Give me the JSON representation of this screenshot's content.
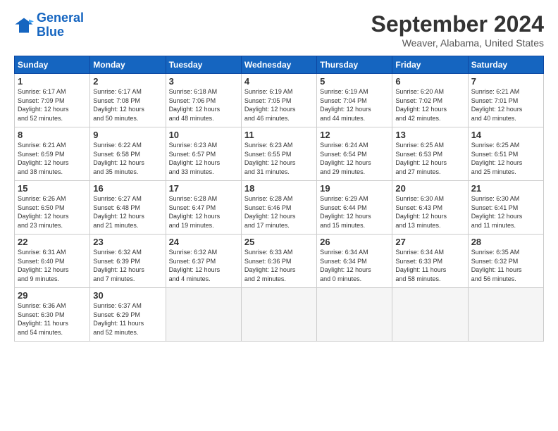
{
  "logo": {
    "line1": "General",
    "line2": "Blue"
  },
  "title": "September 2024",
  "location": "Weaver, Alabama, United States",
  "days_of_week": [
    "Sunday",
    "Monday",
    "Tuesday",
    "Wednesday",
    "Thursday",
    "Friday",
    "Saturday"
  ],
  "weeks": [
    [
      {
        "day": "1",
        "info": "Sunrise: 6:17 AM\nSunset: 7:09 PM\nDaylight: 12 hours\nand 52 minutes."
      },
      {
        "day": "2",
        "info": "Sunrise: 6:17 AM\nSunset: 7:08 PM\nDaylight: 12 hours\nand 50 minutes."
      },
      {
        "day": "3",
        "info": "Sunrise: 6:18 AM\nSunset: 7:06 PM\nDaylight: 12 hours\nand 48 minutes."
      },
      {
        "day": "4",
        "info": "Sunrise: 6:19 AM\nSunset: 7:05 PM\nDaylight: 12 hours\nand 46 minutes."
      },
      {
        "day": "5",
        "info": "Sunrise: 6:19 AM\nSunset: 7:04 PM\nDaylight: 12 hours\nand 44 minutes."
      },
      {
        "day": "6",
        "info": "Sunrise: 6:20 AM\nSunset: 7:02 PM\nDaylight: 12 hours\nand 42 minutes."
      },
      {
        "day": "7",
        "info": "Sunrise: 6:21 AM\nSunset: 7:01 PM\nDaylight: 12 hours\nand 40 minutes."
      }
    ],
    [
      {
        "day": "8",
        "info": "Sunrise: 6:21 AM\nSunset: 6:59 PM\nDaylight: 12 hours\nand 38 minutes."
      },
      {
        "day": "9",
        "info": "Sunrise: 6:22 AM\nSunset: 6:58 PM\nDaylight: 12 hours\nand 35 minutes."
      },
      {
        "day": "10",
        "info": "Sunrise: 6:23 AM\nSunset: 6:57 PM\nDaylight: 12 hours\nand 33 minutes."
      },
      {
        "day": "11",
        "info": "Sunrise: 6:23 AM\nSunset: 6:55 PM\nDaylight: 12 hours\nand 31 minutes."
      },
      {
        "day": "12",
        "info": "Sunrise: 6:24 AM\nSunset: 6:54 PM\nDaylight: 12 hours\nand 29 minutes."
      },
      {
        "day": "13",
        "info": "Sunrise: 6:25 AM\nSunset: 6:53 PM\nDaylight: 12 hours\nand 27 minutes."
      },
      {
        "day": "14",
        "info": "Sunrise: 6:25 AM\nSunset: 6:51 PM\nDaylight: 12 hours\nand 25 minutes."
      }
    ],
    [
      {
        "day": "15",
        "info": "Sunrise: 6:26 AM\nSunset: 6:50 PM\nDaylight: 12 hours\nand 23 minutes."
      },
      {
        "day": "16",
        "info": "Sunrise: 6:27 AM\nSunset: 6:48 PM\nDaylight: 12 hours\nand 21 minutes."
      },
      {
        "day": "17",
        "info": "Sunrise: 6:28 AM\nSunset: 6:47 PM\nDaylight: 12 hours\nand 19 minutes."
      },
      {
        "day": "18",
        "info": "Sunrise: 6:28 AM\nSunset: 6:46 PM\nDaylight: 12 hours\nand 17 minutes."
      },
      {
        "day": "19",
        "info": "Sunrise: 6:29 AM\nSunset: 6:44 PM\nDaylight: 12 hours\nand 15 minutes."
      },
      {
        "day": "20",
        "info": "Sunrise: 6:30 AM\nSunset: 6:43 PM\nDaylight: 12 hours\nand 13 minutes."
      },
      {
        "day": "21",
        "info": "Sunrise: 6:30 AM\nSunset: 6:41 PM\nDaylight: 12 hours\nand 11 minutes."
      }
    ],
    [
      {
        "day": "22",
        "info": "Sunrise: 6:31 AM\nSunset: 6:40 PM\nDaylight: 12 hours\nand 9 minutes."
      },
      {
        "day": "23",
        "info": "Sunrise: 6:32 AM\nSunset: 6:39 PM\nDaylight: 12 hours\nand 7 minutes."
      },
      {
        "day": "24",
        "info": "Sunrise: 6:32 AM\nSunset: 6:37 PM\nDaylight: 12 hours\nand 4 minutes."
      },
      {
        "day": "25",
        "info": "Sunrise: 6:33 AM\nSunset: 6:36 PM\nDaylight: 12 hours\nand 2 minutes."
      },
      {
        "day": "26",
        "info": "Sunrise: 6:34 AM\nSunset: 6:34 PM\nDaylight: 12 hours\nand 0 minutes."
      },
      {
        "day": "27",
        "info": "Sunrise: 6:34 AM\nSunset: 6:33 PM\nDaylight: 11 hours\nand 58 minutes."
      },
      {
        "day": "28",
        "info": "Sunrise: 6:35 AM\nSunset: 6:32 PM\nDaylight: 11 hours\nand 56 minutes."
      }
    ],
    [
      {
        "day": "29",
        "info": "Sunrise: 6:36 AM\nSunset: 6:30 PM\nDaylight: 11 hours\nand 54 minutes."
      },
      {
        "day": "30",
        "info": "Sunrise: 6:37 AM\nSunset: 6:29 PM\nDaylight: 11 hours\nand 52 minutes."
      },
      {
        "day": "",
        "info": ""
      },
      {
        "day": "",
        "info": ""
      },
      {
        "day": "",
        "info": ""
      },
      {
        "day": "",
        "info": ""
      },
      {
        "day": "",
        "info": ""
      }
    ]
  ]
}
